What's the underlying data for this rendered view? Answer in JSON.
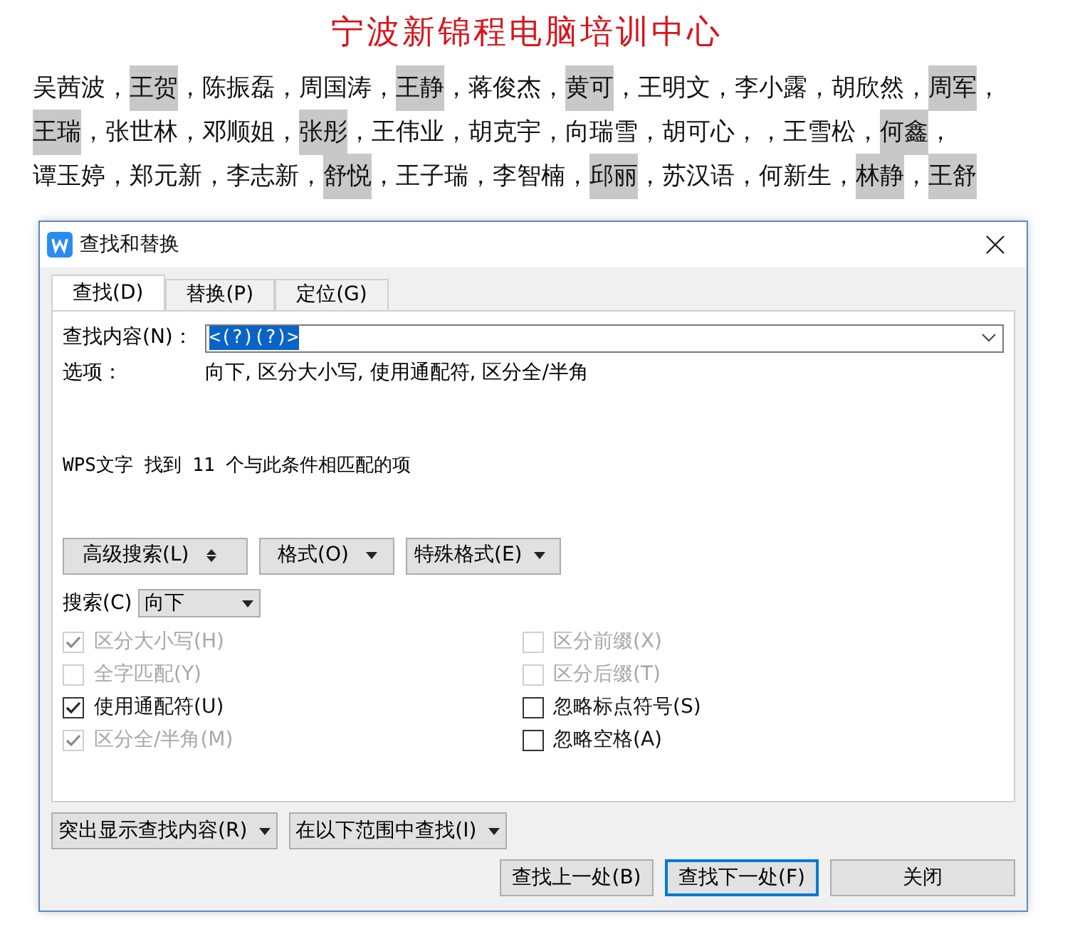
{
  "document": {
    "title": "宁波新锦程电脑培训中心",
    "lines": [
      [
        {
          "name": "吴茜波",
          "sep": "，",
          "highlighted": false
        },
        {
          "name": "王贺",
          "sep": "，",
          "highlighted": true
        },
        {
          "name": "陈振磊",
          "sep": "，",
          "highlighted": false
        },
        {
          "name": "周国涛",
          "sep": "，",
          "highlighted": false
        },
        {
          "name": "王静",
          "sep": "，",
          "highlighted": true
        },
        {
          "name": "蒋俊杰",
          "sep": "，",
          "highlighted": false
        },
        {
          "name": "黄可",
          "sep": "，",
          "highlighted": true
        },
        {
          "name": "王明文",
          "sep": "，",
          "highlighted": false
        },
        {
          "name": "李小露",
          "sep": "，",
          "highlighted": false
        },
        {
          "name": "胡欣然",
          "sep": "，",
          "highlighted": false
        },
        {
          "name": "周军",
          "sep": "，",
          "highlighted": true
        }
      ],
      [
        {
          "name": "王瑞",
          "sep": "，",
          "highlighted": true
        },
        {
          "name": "张世林",
          "sep": "，",
          "highlighted": false
        },
        {
          "name": "邓顺姐",
          "sep": "，",
          "highlighted": false
        },
        {
          "name": "张彤",
          "sep": "，",
          "highlighted": true
        },
        {
          "name": "王伟业",
          "sep": "，",
          "highlighted": false
        },
        {
          "name": "胡克宇",
          "sep": "，",
          "highlighted": false
        },
        {
          "name": "向瑞雪",
          "sep": "，",
          "highlighted": false
        },
        {
          "name": "胡可心",
          "sep": "，，",
          "highlighted": false
        },
        {
          "name": "王雪松",
          "sep": "，",
          "highlighted": false
        },
        {
          "name": "何鑫",
          "sep": "，",
          "highlighted": true
        }
      ],
      [
        {
          "name": "谭玉婷",
          "sep": "，",
          "highlighted": false
        },
        {
          "name": "郑元新",
          "sep": "，",
          "highlighted": false
        },
        {
          "name": "李志新",
          "sep": "，",
          "highlighted": false
        },
        {
          "name": "舒悦",
          "sep": "，",
          "highlighted": true
        },
        {
          "name": "王子瑞",
          "sep": "，",
          "highlighted": false
        },
        {
          "name": "李智楠",
          "sep": "，",
          "highlighted": false
        },
        {
          "name": "邱丽",
          "sep": "，",
          "highlighted": true
        },
        {
          "name": "苏汉语",
          "sep": "，",
          "highlighted": false
        },
        {
          "name": "何新生",
          "sep": "，",
          "highlighted": false
        },
        {
          "name": "林静",
          "sep": "，",
          "highlighted": true
        },
        {
          "name": "王舒",
          "highlighted": true
        }
      ]
    ]
  },
  "dialog": {
    "title": "查找和替换",
    "tabs": [
      {
        "label": "查找(D)",
        "selected": true
      },
      {
        "label": "替换(P)",
        "selected": false
      },
      {
        "label": "定位(G)",
        "selected": false
      }
    ],
    "find_label": "查找内容(N)：",
    "find_value": "<(?)(?)>",
    "options_label": "选项：",
    "options_value": "向下, 区分大小写, 使用通配符, 区分全/半角",
    "result": "WPS文字 找到 11 个与此条件相匹配的项",
    "format_buttons": [
      {
        "label": "高级搜索(L)",
        "kind": "toggle"
      },
      {
        "label": "格式(O)",
        "kind": "menu"
      },
      {
        "label": "特殊格式(E)",
        "kind": "menu"
      }
    ],
    "search_label": "搜索(C)",
    "search_value": "向下",
    "checkboxes_left": [
      {
        "label": "区分大小写(H)",
        "checked": true,
        "disabled": true
      },
      {
        "label": "全字匹配(Y)",
        "checked": false,
        "disabled": true
      },
      {
        "label": "使用通配符(U)",
        "checked": true,
        "disabled": false
      },
      {
        "label": "区分全/半角(M)",
        "checked": true,
        "disabled": true
      }
    ],
    "checkboxes_right": [
      {
        "label": "区分前缀(X)",
        "checked": false,
        "disabled": true
      },
      {
        "label": "区分后缀(T)",
        "checked": false,
        "disabled": true
      },
      {
        "label": "忽略标点符号(S)",
        "checked": false,
        "disabled": false
      },
      {
        "label": "忽略空格(A)",
        "checked": false,
        "disabled": false
      }
    ],
    "bottom_menus": [
      "突出显示查找内容(R)",
      "在以下范围中查找(I)"
    ],
    "actions": [
      {
        "label": "查找上一处(B)",
        "selected": false
      },
      {
        "label": "查找下一处(F)",
        "selected": true
      },
      {
        "label": "关闭",
        "selected": false
      }
    ]
  }
}
